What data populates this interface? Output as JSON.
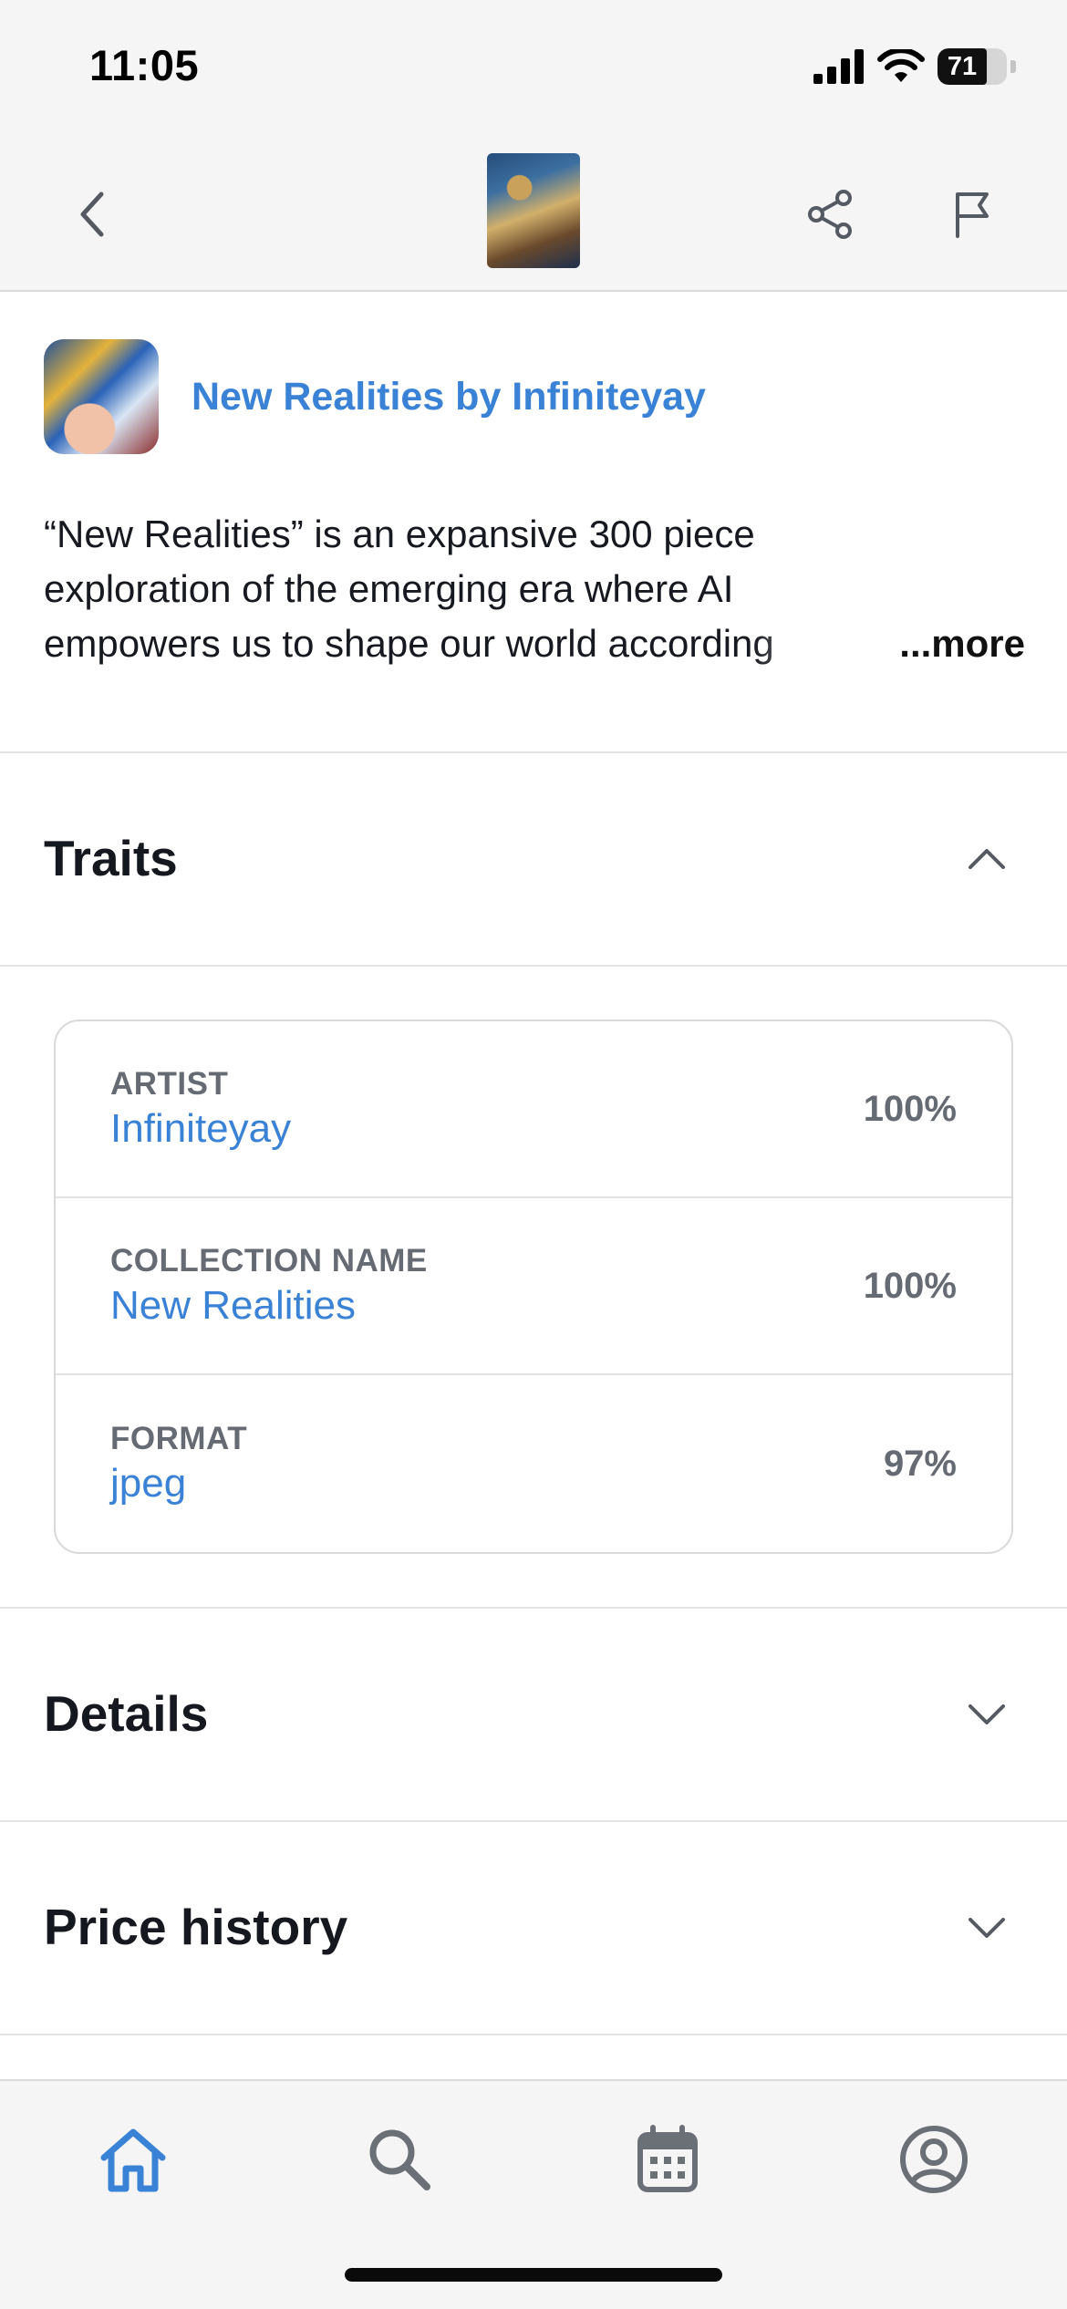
{
  "status_bar": {
    "time": "11:05",
    "battery_level": "71",
    "icons": [
      "signal-icon",
      "wifi-icon",
      "battery-icon"
    ]
  },
  "header": {
    "icons": [
      "back-chevron-icon",
      "share-icon",
      "flag-icon"
    ]
  },
  "collection": {
    "name": "New Realities by Infiniteyay"
  },
  "description": {
    "line1": "“New Realities” is an expansive 300 piece",
    "line2": "exploration of the emerging era where AI",
    "line3": "empowers us to shape our world according",
    "more_label": "...more"
  },
  "sections": {
    "traits_title": "Traits",
    "details_title": "Details",
    "price_history_title": "Price history"
  },
  "traits": [
    {
      "key": "ARTIST",
      "value": "Infiniteyay",
      "percent": "100%"
    },
    {
      "key": "COLLECTION NAME",
      "value": "New Realities",
      "percent": "100%"
    },
    {
      "key": "FORMAT",
      "value": "jpeg",
      "percent": "97%"
    }
  ],
  "tab_bar": {
    "active": "home",
    "tabs": [
      "home-icon",
      "search-icon",
      "calendar-icon",
      "profile-icon"
    ]
  },
  "colors": {
    "accent": "#3a82d6",
    "text": "#15191f",
    "muted": "#666b73",
    "chrome": "#f5f5f6"
  }
}
